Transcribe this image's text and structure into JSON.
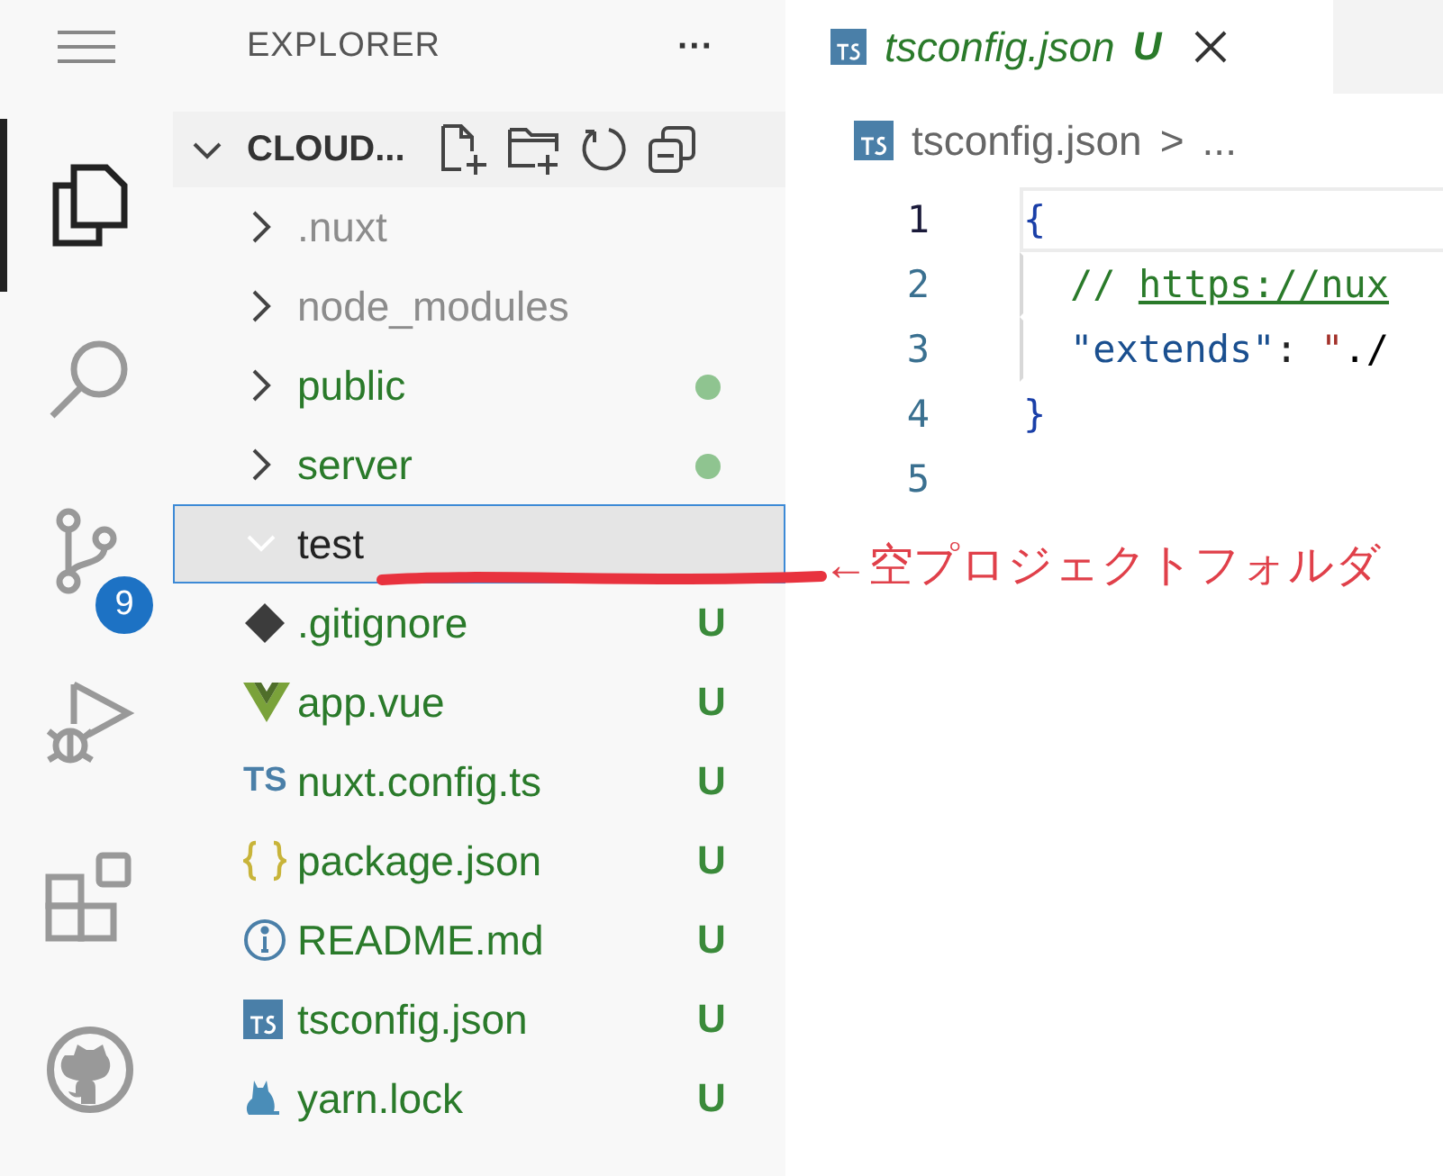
{
  "activity_bar": [
    {
      "kind": "files",
      "selected": true
    },
    {
      "kind": "search",
      "selected": false
    },
    {
      "kind": "branches",
      "selected": false,
      "badge": "9"
    },
    {
      "kind": "debug",
      "selected": false
    },
    {
      "kind": "extensions",
      "selected": false
    },
    {
      "kind": "github",
      "selected": false
    }
  ],
  "sidebar": {
    "title": "EXPLORER",
    "more": "···",
    "section": {
      "title": "CLOUD...",
      "expanded": true
    },
    "items": [
      {
        "kind": "folder",
        "name": ".nuxt",
        "expanded": false,
        "selected": false,
        "color": "#8c8c8c"
      },
      {
        "kind": "folder",
        "name": "node_modules",
        "expanded": false,
        "selected": false,
        "color": "#8c8c8c"
      },
      {
        "kind": "folder",
        "name": "public",
        "expanded": false,
        "selected": false,
        "color": "#2a7a2a",
        "dot": true
      },
      {
        "kind": "folder",
        "name": "server",
        "expanded": false,
        "selected": false,
        "color": "#2a7a2a",
        "dot": true
      },
      {
        "kind": "folder",
        "name": "test",
        "expanded": true,
        "selected": true,
        "color": "#222222"
      },
      {
        "kind": "gitfile",
        "name": ".gitignore",
        "selected": false,
        "color": "#2a7a2a",
        "decoration": "U"
      },
      {
        "kind": "vuefile",
        "name": "app.vue",
        "selected": false,
        "color": "#2a7a2a",
        "decoration": "U"
      },
      {
        "kind": "tsfile",
        "icon_text": "TS",
        "name": "nuxt.config.ts",
        "selected": false,
        "color": "#2a7a2a",
        "decoration": "U"
      },
      {
        "kind": "jsonfile",
        "name": "package.json",
        "selected": false,
        "color": "#2a7a2a",
        "decoration": "U"
      },
      {
        "kind": "infofile",
        "name": "README.md",
        "selected": false,
        "color": "#2a7a2a",
        "decoration": "U"
      },
      {
        "kind": "tsconfigfile",
        "name": "tsconfig.json",
        "selected": false,
        "color": "#2a7a2a",
        "decoration": "U"
      },
      {
        "kind": "yarnfile",
        "name": "yarn.lock",
        "selected": false,
        "color": "#2a7a2a",
        "decoration": "U"
      }
    ]
  },
  "annotation": {
    "text": "←空プロジェクトフォルダ"
  },
  "editor": {
    "tab": {
      "title": "tsconfig.json",
      "decoration": "U",
      "selected": true
    },
    "breadcrumb": {
      "file": "tsconfig.json",
      "separator": ">",
      "rest": "..."
    },
    "lines": [
      {
        "number": "1",
        "current": true,
        "tokens": [
          {
            "kind": "punct",
            "text": "{"
          }
        ]
      },
      {
        "number": "2",
        "current": false,
        "tokens": [
          {
            "kind": "comment",
            "text": "// "
          },
          {
            "kind": "link",
            "text": "https://nux"
          }
        ]
      },
      {
        "number": "3",
        "current": false,
        "tokens": [
          {
            "kind": "key",
            "text": "\"extends\""
          },
          {
            "kind": "plain",
            "text": ": "
          },
          {
            "kind": "string",
            "text": "\""
          },
          {
            "kind": "stringlink",
            "text": "./"
          }
        ]
      },
      {
        "number": "4",
        "current": false,
        "tokens": [
          {
            "kind": "punct",
            "text": "}"
          }
        ]
      },
      {
        "number": "5",
        "current": false
      }
    ]
  }
}
